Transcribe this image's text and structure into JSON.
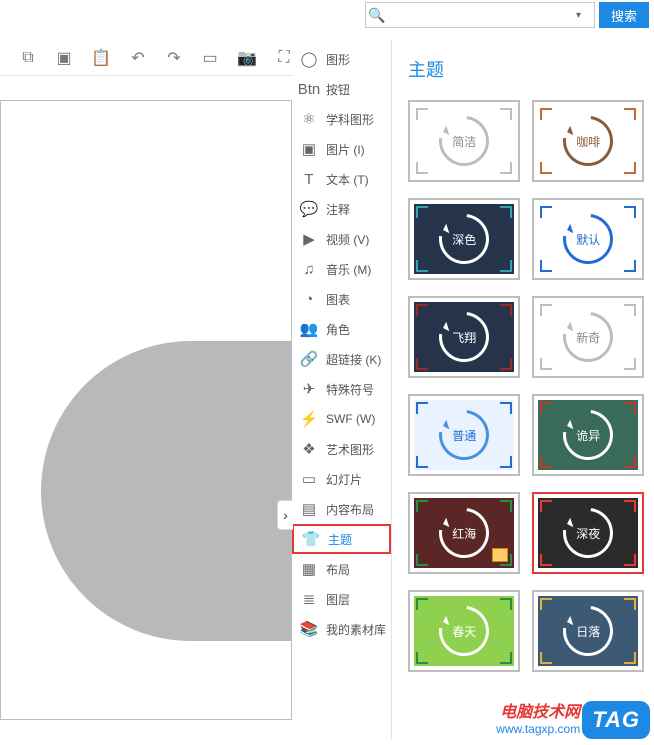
{
  "search": {
    "placeholder": "",
    "button_label": "搜索"
  },
  "toolbar_icons": [
    "copy",
    "paste",
    "clipboard",
    "undo",
    "redo",
    "format-painter",
    "camera",
    "fullscreen"
  ],
  "sidebar": {
    "items": [
      {
        "label": "图形",
        "icon": "◯"
      },
      {
        "label": "按钮",
        "icon": "Btn"
      },
      {
        "label": "学科图形",
        "icon": "⚛"
      },
      {
        "label": "图片 (I)",
        "icon": "▣"
      },
      {
        "label": "文本 (T)",
        "icon": "T"
      },
      {
        "label": "注释",
        "icon": "💬"
      },
      {
        "label": "视频 (V)",
        "icon": "▶"
      },
      {
        "label": "音乐 (M)",
        "icon": "♫"
      },
      {
        "label": "图表",
        "icon": "◔"
      },
      {
        "label": "角色",
        "icon": "👥"
      },
      {
        "label": "超链接 (K)",
        "icon": "🔗"
      },
      {
        "label": "特殊符号",
        "icon": "✈"
      },
      {
        "label": "SWF (W)",
        "icon": "⚡"
      },
      {
        "label": "艺术图形",
        "icon": "❖"
      },
      {
        "label": "幻灯片",
        "icon": "▭"
      },
      {
        "label": "内容布局",
        "icon": "▤"
      },
      {
        "label": "主题",
        "icon": "👕",
        "active": true
      },
      {
        "label": "布局",
        "icon": "▦"
      },
      {
        "label": "图层",
        "icon": "≣"
      },
      {
        "label": "我的素材库",
        "icon": "📚"
      }
    ]
  },
  "panel": {
    "title": "主题",
    "themes": [
      {
        "name": "简洁",
        "bg": "#ffffff",
        "ring": "#bdbdbd",
        "corner": "#bdbdbd",
        "text": "#888888"
      },
      {
        "name": "咖啡",
        "bg": "#ffffff",
        "ring": "#8d5a3b",
        "corner": "#c46a3e",
        "text": "#8d5a3b"
      },
      {
        "name": "深色",
        "bg": "#25344a",
        "ring": "#ffffff",
        "corner": "#33a1b8",
        "text": "#ffffff"
      },
      {
        "name": "默认",
        "bg": "#ffffff",
        "ring": "#236bd6",
        "corner": "#236bd6",
        "text": "#236bd6"
      },
      {
        "name": "飞翔",
        "bg": "#25344a",
        "ring": "#ffffff",
        "corner": "#9a2a2a",
        "text": "#ffffff"
      },
      {
        "name": "新奇",
        "bg": "#ffffff",
        "ring": "#bdbdbd",
        "corner": "#bdbdbd",
        "text": "#888888"
      },
      {
        "name": "普通",
        "bg": "#e9f3ff",
        "ring": "#4a8fe0",
        "corner": "#236bd6",
        "text": "#236bd6"
      },
      {
        "name": "诡异",
        "bg": "#3a6a58",
        "ring": "#ffffff",
        "corner": "#c0392b",
        "text": "#ffffff"
      },
      {
        "name": "红海",
        "bg": "#5a2626",
        "ring": "#ffffff",
        "corner": "#2a8d3f",
        "text": "#ffffff",
        "badge": true
      },
      {
        "name": "深夜",
        "bg": "#2b2b2b",
        "ring": "#ffffff",
        "corner": "#e53935",
        "text": "#ffffff",
        "selected": true
      },
      {
        "name": "春天",
        "bg": "#8fd14f",
        "ring": "#ffffff",
        "corner": "#2a8d3f",
        "text": "#ffffff"
      },
      {
        "name": "日落",
        "bg": "#3d5a74",
        "ring": "#ffffff",
        "corner": "#e7a93b",
        "text": "#ffffff"
      }
    ]
  },
  "watermark": {
    "line1": "电脑技术网",
    "line2": "www.tagxp.com",
    "tag": "TAG"
  }
}
